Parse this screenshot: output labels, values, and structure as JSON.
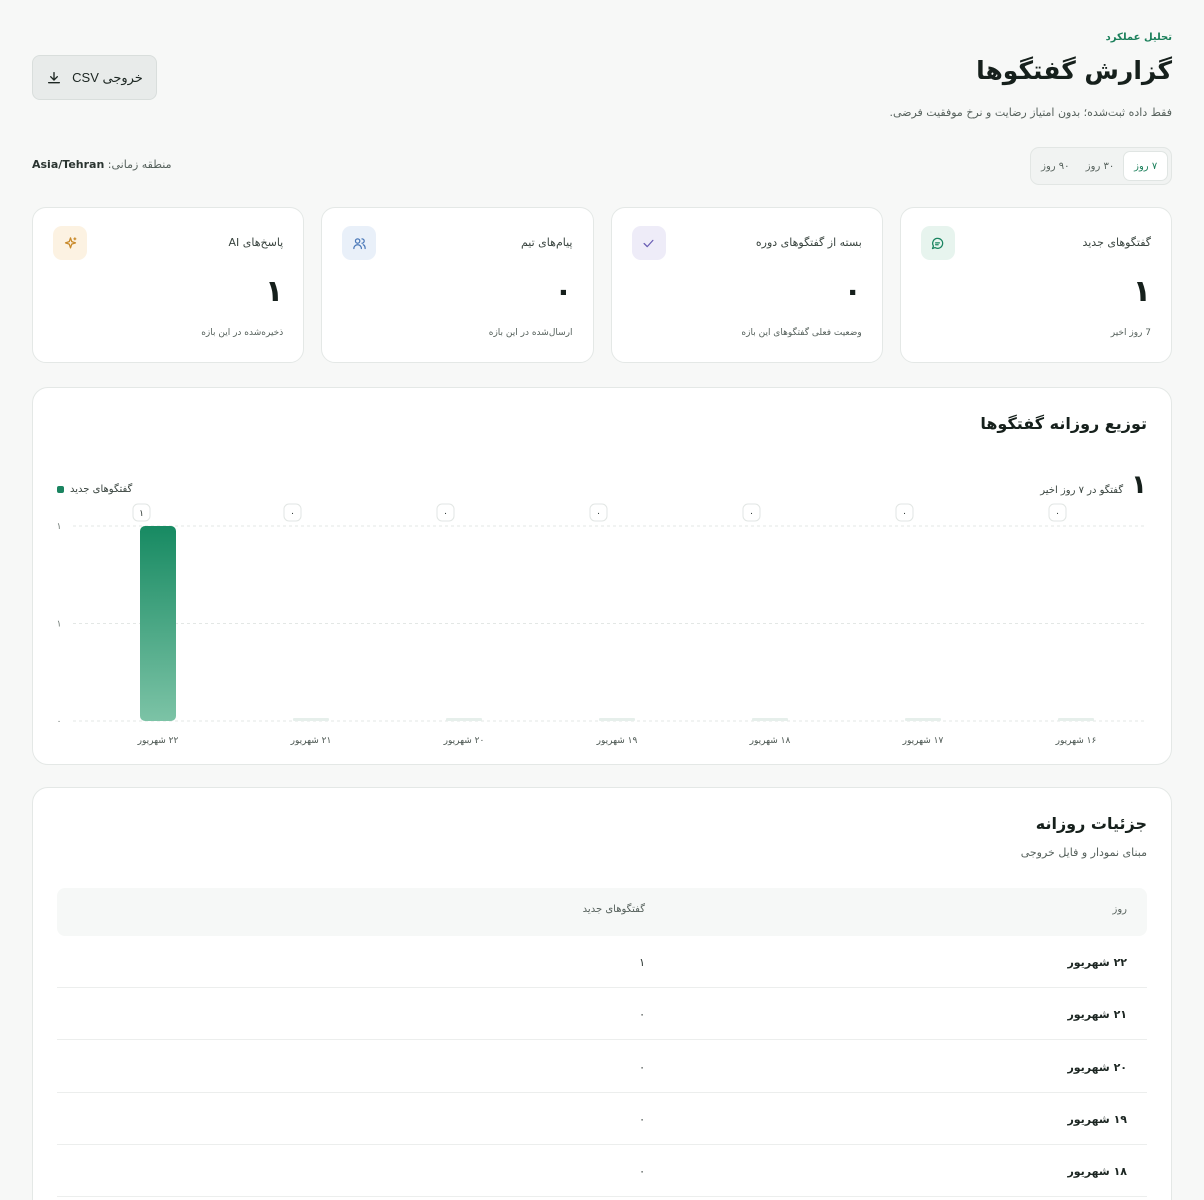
{
  "header": {
    "eyebrow": "تحلیل عملکرد",
    "title": "گزارش گفتگوها",
    "subtitle": "فقط داده ثبت‌شده؛ بدون امتیاز رضایت و نرخ موفقیت فرضی.",
    "export_label": "خروجی CSV"
  },
  "range": {
    "options": [
      "۷ روز",
      "۳۰ روز",
      "۹۰ روز"
    ],
    "selected": "۷ روز"
  },
  "timezone": {
    "label": "منطقه زمانی:",
    "value": "Asia/Tehran"
  },
  "stats": [
    {
      "label": "گفتگوهای جدید",
      "value": "۱",
      "note": "7 روز اخیر",
      "icon": "chat-icon",
      "icon_color": "#1a8460",
      "icon_bg": "#e7f4ee"
    },
    {
      "label": "بسته از گفتگوهای دوره",
      "value": "۰",
      "note": "وضعیت فعلی گفتگوهای این بازه",
      "icon": "check-icon",
      "icon_color": "#6b5fb5",
      "icon_bg": "#eeecf8"
    },
    {
      "label": "پیام‌های تیم",
      "value": "۰",
      "note": "ارسال‌شده در این بازه",
      "icon": "users-icon",
      "icon_color": "#4a78b8",
      "icon_bg": "#e9f0f9"
    },
    {
      "label": "پاسخ‌های AI",
      "value": "۱",
      "note": "ذخیره‌شده در این بازه",
      "icon": "sparkle-icon",
      "icon_color": "#c98a2a",
      "icon_bg": "#fcf2e2"
    }
  ],
  "chart": {
    "title": "توزیع روزانه گفتگوها",
    "total_value": "۱",
    "total_label": "گفتگو در ۷ روز اخیر",
    "legend": "گفتگوهای جدید"
  },
  "chart_data": {
    "type": "bar",
    "categories": [
      "۲۲ شهریور",
      "۲۱ شهریور",
      "۲۰ شهریور",
      "۱۹ شهریور",
      "۱۸ شهریور",
      "۱۷ شهریور",
      "۱۶ شهریور"
    ],
    "values": [
      1,
      0,
      0,
      0,
      0,
      0,
      0
    ],
    "value_labels": [
      "۱",
      "۰",
      "۰",
      "۰",
      "۰",
      "۰",
      "۰"
    ],
    "y_ticks": [
      "۱",
      "۱",
      "۰"
    ],
    "ylim": [
      0,
      1
    ],
    "series": [
      {
        "name": "گفتگوهای جدید",
        "values": [
          1,
          0,
          0,
          0,
          0,
          0,
          0
        ]
      }
    ],
    "grid": true,
    "legend_position": "top-left",
    "bar_color": "#1a8460"
  },
  "table": {
    "title": "جزئیات روزانه",
    "subtitle": "مبنای نمودار و فایل خروجی",
    "columns": [
      "روز",
      "گفتگوهای جدید"
    ],
    "rows": [
      {
        "day": "۲۲ شهریور",
        "count": "۱"
      },
      {
        "day": "۲۱ شهریور",
        "count": "۰"
      },
      {
        "day": "۲۰ شهریور",
        "count": "۰"
      },
      {
        "day": "۱۹ شهریور",
        "count": "۰"
      },
      {
        "day": "۱۸ شهریور",
        "count": "۰"
      }
    ]
  }
}
